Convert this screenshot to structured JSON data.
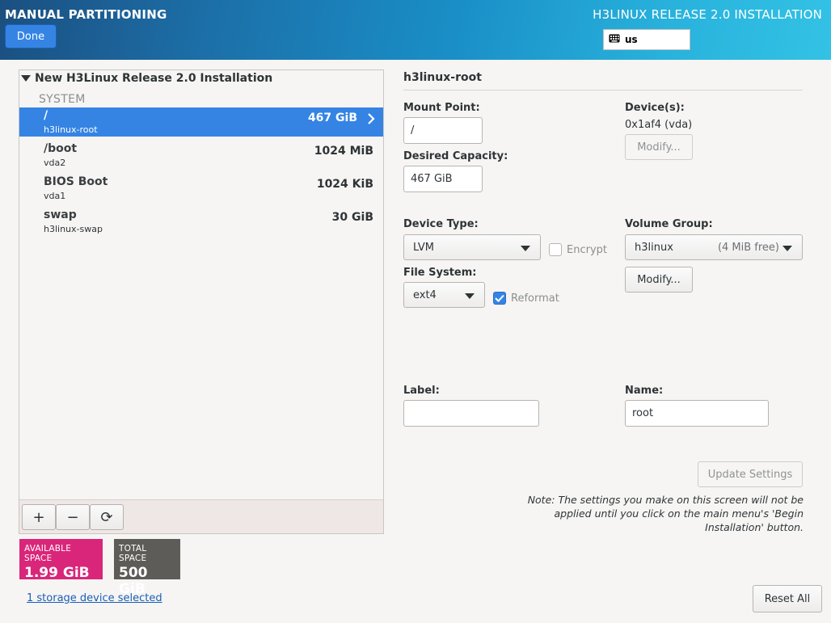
{
  "header": {
    "title": "MANUAL PARTITIONING",
    "done_label": "Done",
    "install_title": "H3LINUX RELEASE 2.0 INSTALLATION",
    "keyboard_layout": "us"
  },
  "left": {
    "group_title": "New H3Linux Release 2.0 Installation",
    "section_label": "SYSTEM",
    "partitions": [
      {
        "name": "/",
        "sub": "h3linux-root",
        "size": "467 GiB"
      },
      {
        "name": "/boot",
        "sub": "vda2",
        "size": "1024 MiB"
      },
      {
        "name": "BIOS Boot",
        "sub": "vda1",
        "size": "1024 KiB"
      },
      {
        "name": "swap",
        "sub": "h3linux-swap",
        "size": "30 GiB"
      }
    ],
    "toolbar": {
      "add": "+",
      "remove": "−",
      "refresh": "⟳"
    }
  },
  "space": {
    "available_label": "AVAILABLE SPACE",
    "available_value": "1.99 GiB",
    "total_label": "TOTAL SPACE",
    "total_value": "500 GiB"
  },
  "storage_link": "1 storage device selected",
  "detail": {
    "title": "h3linux-root",
    "mount_point_label": "Mount Point:",
    "mount_point_value": "/",
    "desired_capacity_label": "Desired Capacity:",
    "desired_capacity_value": "467 GiB",
    "devices_label": "Device(s):",
    "devices_value": "0x1af4 (vda)",
    "devices_modify": "Modify...",
    "device_type_label": "Device Type:",
    "device_type_value": "LVM",
    "encrypt_label": "Encrypt",
    "volume_group_label": "Volume Group:",
    "volume_group_value": "h3linux",
    "volume_group_free": "(4 MiB free)",
    "volume_group_modify": "Modify...",
    "file_system_label": "File System:",
    "file_system_value": "ext4",
    "reformat_label": "Reformat",
    "label_label": "Label:",
    "label_value": "",
    "name_label": "Name:",
    "name_value": "root",
    "update_settings": "Update Settings",
    "note": "Note:  The settings you make on this screen will not be applied until you click on the main menu's 'Begin Installation' button.",
    "reset_all": "Reset All"
  }
}
